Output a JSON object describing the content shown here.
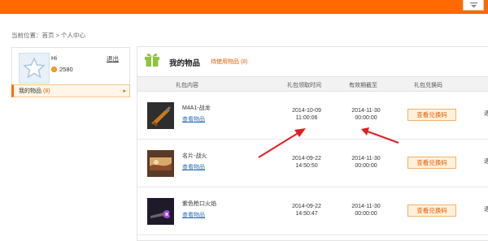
{
  "breadcrumb": "当前位置：首页 > 个人中心",
  "profile": {
    "name": "Hi",
    "logout": "退出",
    "points": "2580"
  },
  "sidebar": {
    "item_label": "我的物品",
    "item_count": "(8)",
    "arrow": "▸"
  },
  "panel": {
    "title": "我的物品",
    "subtitle": "待使用物品 (8)"
  },
  "table": {
    "headers": [
      "礼包内容",
      "礼包领取时间",
      "有效期截至",
      "礼包兑换码"
    ],
    "rows": [
      {
        "name": "M4A1-战龙",
        "view": "查看物品",
        "claim_date": "2014-10-09",
        "claim_time": "11:00:06",
        "expire_date": "2014-11-30",
        "expire_time": "00:00:00",
        "button": "查看兑换码",
        "edge": "退"
      },
      {
        "name": "名片-战火",
        "view": "查看物品",
        "claim_date": "2014-09-22",
        "claim_time": "14:50:50",
        "expire_date": "2014-11-30",
        "expire_time": "00:00:00",
        "button": "查看兑换码",
        "edge": "退"
      },
      {
        "name": "紫色枪口火焰",
        "view": "查看物品",
        "claim_date": "2014-09-22",
        "claim_time": "14:50:47",
        "expire_date": "2014-11-30",
        "expire_time": "00:00:00",
        "button": "查看兑换码",
        "edge": "退"
      }
    ]
  },
  "colors": {
    "accent": "#ff6a00",
    "link": "#2a6db4",
    "arrow": "#e0201f",
    "gift": "#8cc43e"
  }
}
